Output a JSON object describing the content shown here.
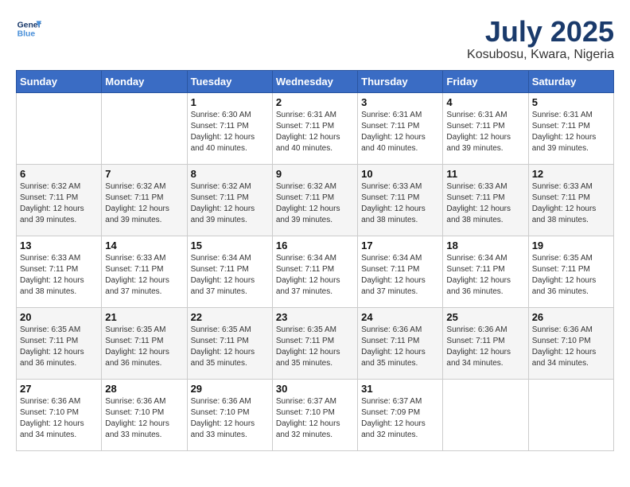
{
  "header": {
    "logo_line1": "General",
    "logo_line2": "Blue",
    "month_title": "July 2025",
    "location": "Kosubosu, Kwara, Nigeria"
  },
  "weekdays": [
    "Sunday",
    "Monday",
    "Tuesday",
    "Wednesday",
    "Thursday",
    "Friday",
    "Saturday"
  ],
  "weeks": [
    [
      {
        "day": "",
        "info": ""
      },
      {
        "day": "",
        "info": ""
      },
      {
        "day": "1",
        "info": "Sunrise: 6:30 AM\nSunset: 7:11 PM\nDaylight: 12 hours\nand 40 minutes."
      },
      {
        "day": "2",
        "info": "Sunrise: 6:31 AM\nSunset: 7:11 PM\nDaylight: 12 hours\nand 40 minutes."
      },
      {
        "day": "3",
        "info": "Sunrise: 6:31 AM\nSunset: 7:11 PM\nDaylight: 12 hours\nand 40 minutes."
      },
      {
        "day": "4",
        "info": "Sunrise: 6:31 AM\nSunset: 7:11 PM\nDaylight: 12 hours\nand 39 minutes."
      },
      {
        "day": "5",
        "info": "Sunrise: 6:31 AM\nSunset: 7:11 PM\nDaylight: 12 hours\nand 39 minutes."
      }
    ],
    [
      {
        "day": "6",
        "info": "Sunrise: 6:32 AM\nSunset: 7:11 PM\nDaylight: 12 hours\nand 39 minutes."
      },
      {
        "day": "7",
        "info": "Sunrise: 6:32 AM\nSunset: 7:11 PM\nDaylight: 12 hours\nand 39 minutes."
      },
      {
        "day": "8",
        "info": "Sunrise: 6:32 AM\nSunset: 7:11 PM\nDaylight: 12 hours\nand 39 minutes."
      },
      {
        "day": "9",
        "info": "Sunrise: 6:32 AM\nSunset: 7:11 PM\nDaylight: 12 hours\nand 39 minutes."
      },
      {
        "day": "10",
        "info": "Sunrise: 6:33 AM\nSunset: 7:11 PM\nDaylight: 12 hours\nand 38 minutes."
      },
      {
        "day": "11",
        "info": "Sunrise: 6:33 AM\nSunset: 7:11 PM\nDaylight: 12 hours\nand 38 minutes."
      },
      {
        "day": "12",
        "info": "Sunrise: 6:33 AM\nSunset: 7:11 PM\nDaylight: 12 hours\nand 38 minutes."
      }
    ],
    [
      {
        "day": "13",
        "info": "Sunrise: 6:33 AM\nSunset: 7:11 PM\nDaylight: 12 hours\nand 38 minutes."
      },
      {
        "day": "14",
        "info": "Sunrise: 6:33 AM\nSunset: 7:11 PM\nDaylight: 12 hours\nand 37 minutes."
      },
      {
        "day": "15",
        "info": "Sunrise: 6:34 AM\nSunset: 7:11 PM\nDaylight: 12 hours\nand 37 minutes."
      },
      {
        "day": "16",
        "info": "Sunrise: 6:34 AM\nSunset: 7:11 PM\nDaylight: 12 hours\nand 37 minutes."
      },
      {
        "day": "17",
        "info": "Sunrise: 6:34 AM\nSunset: 7:11 PM\nDaylight: 12 hours\nand 37 minutes."
      },
      {
        "day": "18",
        "info": "Sunrise: 6:34 AM\nSunset: 7:11 PM\nDaylight: 12 hours\nand 36 minutes."
      },
      {
        "day": "19",
        "info": "Sunrise: 6:35 AM\nSunset: 7:11 PM\nDaylight: 12 hours\nand 36 minutes."
      }
    ],
    [
      {
        "day": "20",
        "info": "Sunrise: 6:35 AM\nSunset: 7:11 PM\nDaylight: 12 hours\nand 36 minutes."
      },
      {
        "day": "21",
        "info": "Sunrise: 6:35 AM\nSunset: 7:11 PM\nDaylight: 12 hours\nand 36 minutes."
      },
      {
        "day": "22",
        "info": "Sunrise: 6:35 AM\nSunset: 7:11 PM\nDaylight: 12 hours\nand 35 minutes."
      },
      {
        "day": "23",
        "info": "Sunrise: 6:35 AM\nSunset: 7:11 PM\nDaylight: 12 hours\nand 35 minutes."
      },
      {
        "day": "24",
        "info": "Sunrise: 6:36 AM\nSunset: 7:11 PM\nDaylight: 12 hours\nand 35 minutes."
      },
      {
        "day": "25",
        "info": "Sunrise: 6:36 AM\nSunset: 7:11 PM\nDaylight: 12 hours\nand 34 minutes."
      },
      {
        "day": "26",
        "info": "Sunrise: 6:36 AM\nSunset: 7:10 PM\nDaylight: 12 hours\nand 34 minutes."
      }
    ],
    [
      {
        "day": "27",
        "info": "Sunrise: 6:36 AM\nSunset: 7:10 PM\nDaylight: 12 hours\nand 34 minutes."
      },
      {
        "day": "28",
        "info": "Sunrise: 6:36 AM\nSunset: 7:10 PM\nDaylight: 12 hours\nand 33 minutes."
      },
      {
        "day": "29",
        "info": "Sunrise: 6:36 AM\nSunset: 7:10 PM\nDaylight: 12 hours\nand 33 minutes."
      },
      {
        "day": "30",
        "info": "Sunrise: 6:37 AM\nSunset: 7:10 PM\nDaylight: 12 hours\nand 32 minutes."
      },
      {
        "day": "31",
        "info": "Sunrise: 6:37 AM\nSunset: 7:09 PM\nDaylight: 12 hours\nand 32 minutes."
      },
      {
        "day": "",
        "info": ""
      },
      {
        "day": "",
        "info": ""
      }
    ]
  ]
}
